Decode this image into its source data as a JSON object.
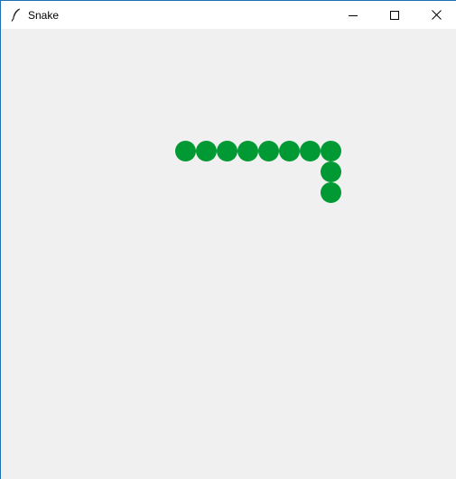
{
  "window": {
    "title": "Snake",
    "app_icon": "feather-icon",
    "controls": [
      "minimize-icon",
      "maximize-icon",
      "close-icon"
    ]
  },
  "game": {
    "snake_color": "#009933",
    "background_color": "#f0f0f0",
    "snake": [
      {
        "col": 0,
        "row": 0
      },
      {
        "col": 1,
        "row": 0
      },
      {
        "col": 2,
        "row": 0
      },
      {
        "col": 3,
        "row": 0
      },
      {
        "col": 4,
        "row": 0
      },
      {
        "col": 5,
        "row": 0
      },
      {
        "col": 6,
        "row": 0
      },
      {
        "col": 7,
        "row": 0
      },
      {
        "col": 7,
        "row": 1
      },
      {
        "col": 7,
        "row": 2
      }
    ]
  }
}
